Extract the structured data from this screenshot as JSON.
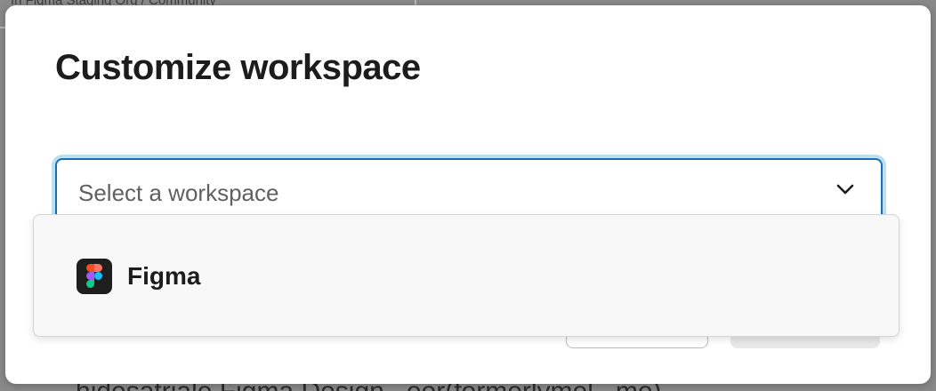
{
  "background": {
    "breadcrumb": "In Figma Staging Org / Community",
    "footer_text": "...hidesatriale Figma Design...eer(formerlymel...me)"
  },
  "modal": {
    "title": "Customize workspace",
    "select": {
      "placeholder": "Select a workspace",
      "icon": "chevron-down-icon"
    },
    "accent_color": "#1d6ab6"
  },
  "dropdown": {
    "options": [
      {
        "label": "Figma",
        "icon": "figma-logo-icon"
      }
    ]
  }
}
